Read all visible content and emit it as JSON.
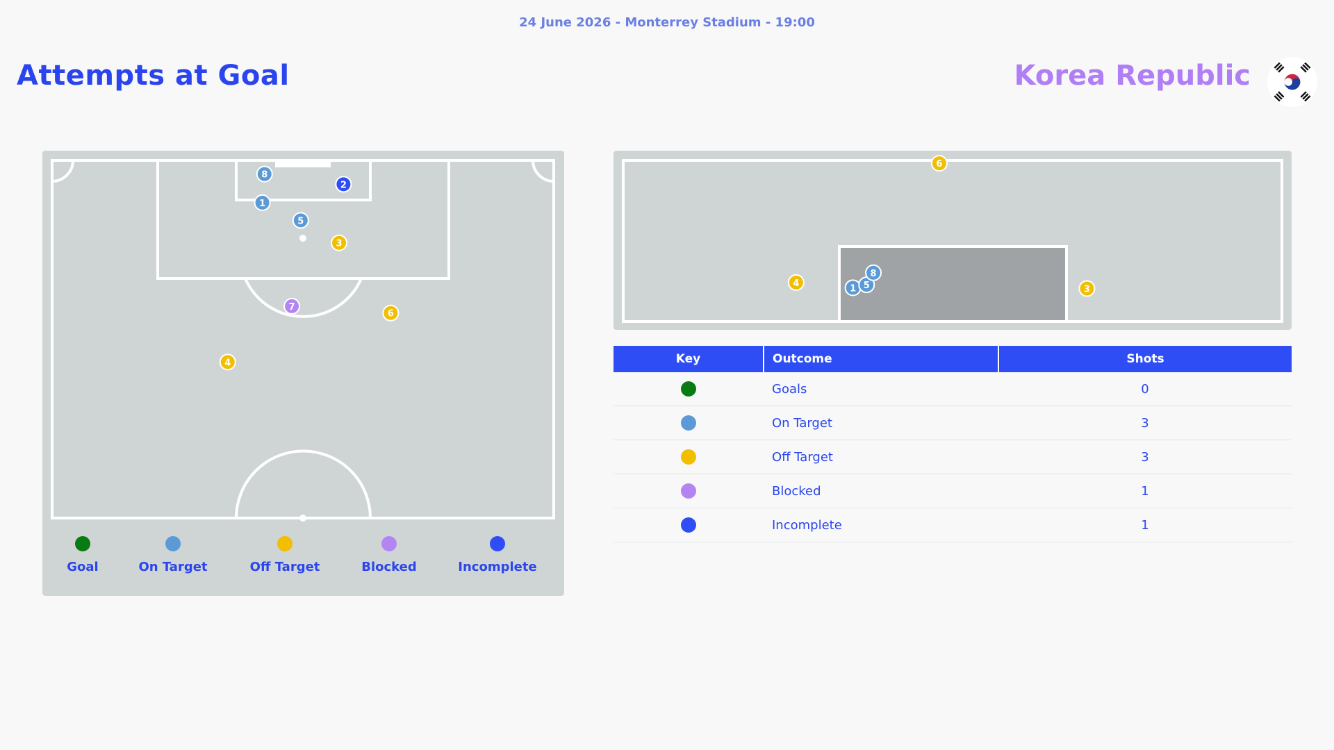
{
  "header": {
    "match_info": "24 June 2026 - Monterrey Stadium - 19:00",
    "title": "Attempts at Goal",
    "team": "Korea Republic"
  },
  "colors": {
    "goal": "#0a7a12",
    "on_target": "#5b9ad6",
    "off_target": "#f2be00",
    "blocked": "#b385f2",
    "incomplete": "#2e4df5"
  },
  "legend": [
    {
      "label": "Goal",
      "color": "#0a7a12"
    },
    {
      "label": "On Target",
      "color": "#5b9ad6"
    },
    {
      "label": "Off Target",
      "color": "#f2be00"
    },
    {
      "label": "Blocked",
      "color": "#b385f2"
    },
    {
      "label": "Incomplete",
      "color": "#2e4df5"
    }
  ],
  "table": {
    "headers": {
      "key": "Key",
      "outcome": "Outcome",
      "shots": "Shots"
    },
    "rows": [
      {
        "outcome": "Goals",
        "shots": "0",
        "color": "#0a7a12"
      },
      {
        "outcome": "On Target",
        "shots": "3",
        "color": "#5b9ad6"
      },
      {
        "outcome": "Off Target",
        "shots": "3",
        "color": "#f2be00"
      },
      {
        "outcome": "Blocked",
        "shots": "1",
        "color": "#b385f2"
      },
      {
        "outcome": "Incomplete",
        "shots": "1",
        "color": "#2e4df5"
      }
    ]
  },
  "chart_data": [
    {
      "type": "scatter",
      "x_unit": "m from left touchline",
      "y_unit": "m from goal line",
      "xlim": [
        0,
        68
      ],
      "ylim": [
        0,
        52.5
      ],
      "points": [
        {
          "label": "1",
          "outcome": "On Target",
          "x": 28.5,
          "y": 6.2
        },
        {
          "label": "2",
          "outcome": "Incomplete",
          "x": 39.5,
          "y": 3.5
        },
        {
          "label": "3",
          "outcome": "Off Target",
          "x": 38.9,
          "y": 12.1
        },
        {
          "label": "4",
          "outcome": "Off Target",
          "x": 23.8,
          "y": 29.6
        },
        {
          "label": "5",
          "outcome": "On Target",
          "x": 33.7,
          "y": 8.8
        },
        {
          "label": "6",
          "outcome": "Off Target",
          "x": 45.9,
          "y": 22.4
        },
        {
          "label": "7",
          "outcome": "Blocked",
          "x": 32.5,
          "y": 21.4
        },
        {
          "label": "8",
          "outcome": "On Target",
          "x": 28.8,
          "y": 2.0
        }
      ]
    },
    {
      "type": "scatter",
      "x_unit": "relative to goal width (0 = left post, 1 = right post)",
      "y_unit": "relative to goal height (0 = ground, 1 = crossbar)",
      "points": [
        {
          "label": "1",
          "outcome": "On Target",
          "x": 0.06,
          "y": 0.45
        },
        {
          "label": "3",
          "outcome": "Off Target",
          "x": 1.09,
          "y": 0.44
        },
        {
          "label": "4",
          "outcome": "Off Target",
          "x": -0.19,
          "y": 0.52
        },
        {
          "label": "5",
          "outcome": "On Target",
          "x": 0.12,
          "y": 0.49
        },
        {
          "label": "6",
          "outcome": "Off Target",
          "x": 0.44,
          "y": 2.11
        },
        {
          "label": "8",
          "outcome": "On Target",
          "x": 0.15,
          "y": 0.65
        }
      ]
    }
  ]
}
